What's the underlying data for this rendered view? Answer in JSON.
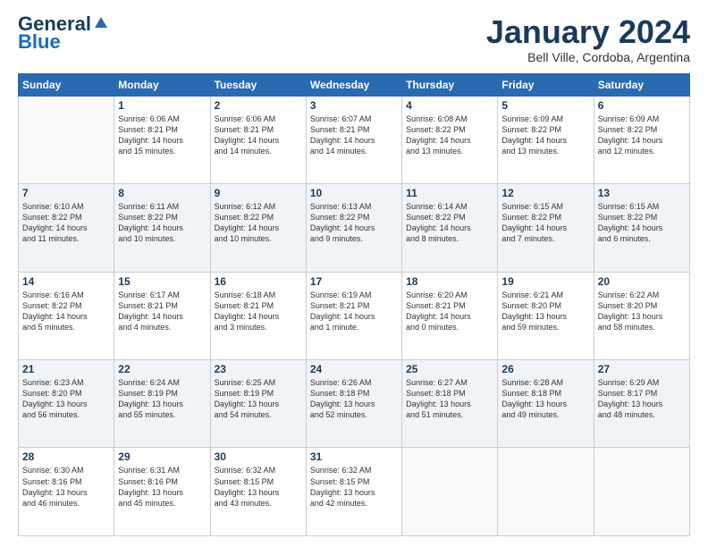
{
  "header": {
    "logo_general": "General",
    "logo_blue": "Blue",
    "month_year": "January 2024",
    "location": "Bell Ville, Cordoba, Argentina"
  },
  "days_of_week": [
    "Sunday",
    "Monday",
    "Tuesday",
    "Wednesday",
    "Thursday",
    "Friday",
    "Saturday"
  ],
  "weeks": [
    [
      {
        "day": "",
        "info": ""
      },
      {
        "day": "1",
        "info": "Sunrise: 6:06 AM\nSunset: 8:21 PM\nDaylight: 14 hours\nand 15 minutes."
      },
      {
        "day": "2",
        "info": "Sunrise: 6:06 AM\nSunset: 8:21 PM\nDaylight: 14 hours\nand 14 minutes."
      },
      {
        "day": "3",
        "info": "Sunrise: 6:07 AM\nSunset: 8:21 PM\nDaylight: 14 hours\nand 14 minutes."
      },
      {
        "day": "4",
        "info": "Sunrise: 6:08 AM\nSunset: 8:22 PM\nDaylight: 14 hours\nand 13 minutes."
      },
      {
        "day": "5",
        "info": "Sunrise: 6:09 AM\nSunset: 8:22 PM\nDaylight: 14 hours\nand 13 minutes."
      },
      {
        "day": "6",
        "info": "Sunrise: 6:09 AM\nSunset: 8:22 PM\nDaylight: 14 hours\nand 12 minutes."
      }
    ],
    [
      {
        "day": "7",
        "info": "Sunrise: 6:10 AM\nSunset: 8:22 PM\nDaylight: 14 hours\nand 11 minutes."
      },
      {
        "day": "8",
        "info": "Sunrise: 6:11 AM\nSunset: 8:22 PM\nDaylight: 14 hours\nand 10 minutes."
      },
      {
        "day": "9",
        "info": "Sunrise: 6:12 AM\nSunset: 8:22 PM\nDaylight: 14 hours\nand 10 minutes."
      },
      {
        "day": "10",
        "info": "Sunrise: 6:13 AM\nSunset: 8:22 PM\nDaylight: 14 hours\nand 9 minutes."
      },
      {
        "day": "11",
        "info": "Sunrise: 6:14 AM\nSunset: 8:22 PM\nDaylight: 14 hours\nand 8 minutes."
      },
      {
        "day": "12",
        "info": "Sunrise: 6:15 AM\nSunset: 8:22 PM\nDaylight: 14 hours\nand 7 minutes."
      },
      {
        "day": "13",
        "info": "Sunrise: 6:15 AM\nSunset: 8:22 PM\nDaylight: 14 hours\nand 6 minutes."
      }
    ],
    [
      {
        "day": "14",
        "info": "Sunrise: 6:16 AM\nSunset: 8:22 PM\nDaylight: 14 hours\nand 5 minutes."
      },
      {
        "day": "15",
        "info": "Sunrise: 6:17 AM\nSunset: 8:21 PM\nDaylight: 14 hours\nand 4 minutes."
      },
      {
        "day": "16",
        "info": "Sunrise: 6:18 AM\nSunset: 8:21 PM\nDaylight: 14 hours\nand 3 minutes."
      },
      {
        "day": "17",
        "info": "Sunrise: 6:19 AM\nSunset: 8:21 PM\nDaylight: 14 hours\nand 1 minute."
      },
      {
        "day": "18",
        "info": "Sunrise: 6:20 AM\nSunset: 8:21 PM\nDaylight: 14 hours\nand 0 minutes."
      },
      {
        "day": "19",
        "info": "Sunrise: 6:21 AM\nSunset: 8:20 PM\nDaylight: 13 hours\nand 59 minutes."
      },
      {
        "day": "20",
        "info": "Sunrise: 6:22 AM\nSunset: 8:20 PM\nDaylight: 13 hours\nand 58 minutes."
      }
    ],
    [
      {
        "day": "21",
        "info": "Sunrise: 6:23 AM\nSunset: 8:20 PM\nDaylight: 13 hours\nand 56 minutes."
      },
      {
        "day": "22",
        "info": "Sunrise: 6:24 AM\nSunset: 8:19 PM\nDaylight: 13 hours\nand 55 minutes."
      },
      {
        "day": "23",
        "info": "Sunrise: 6:25 AM\nSunset: 8:19 PM\nDaylight: 13 hours\nand 54 minutes."
      },
      {
        "day": "24",
        "info": "Sunrise: 6:26 AM\nSunset: 8:18 PM\nDaylight: 13 hours\nand 52 minutes."
      },
      {
        "day": "25",
        "info": "Sunrise: 6:27 AM\nSunset: 8:18 PM\nDaylight: 13 hours\nand 51 minutes."
      },
      {
        "day": "26",
        "info": "Sunrise: 6:28 AM\nSunset: 8:18 PM\nDaylight: 13 hours\nand 49 minutes."
      },
      {
        "day": "27",
        "info": "Sunrise: 6:29 AM\nSunset: 8:17 PM\nDaylight: 13 hours\nand 48 minutes."
      }
    ],
    [
      {
        "day": "28",
        "info": "Sunrise: 6:30 AM\nSunset: 8:16 PM\nDaylight: 13 hours\nand 46 minutes."
      },
      {
        "day": "29",
        "info": "Sunrise: 6:31 AM\nSunset: 8:16 PM\nDaylight: 13 hours\nand 45 minutes."
      },
      {
        "day": "30",
        "info": "Sunrise: 6:32 AM\nSunset: 8:15 PM\nDaylight: 13 hours\nand 43 minutes."
      },
      {
        "day": "31",
        "info": "Sunrise: 6:32 AM\nSunset: 8:15 PM\nDaylight: 13 hours\nand 42 minutes."
      },
      {
        "day": "",
        "info": ""
      },
      {
        "day": "",
        "info": ""
      },
      {
        "day": "",
        "info": ""
      }
    ]
  ]
}
